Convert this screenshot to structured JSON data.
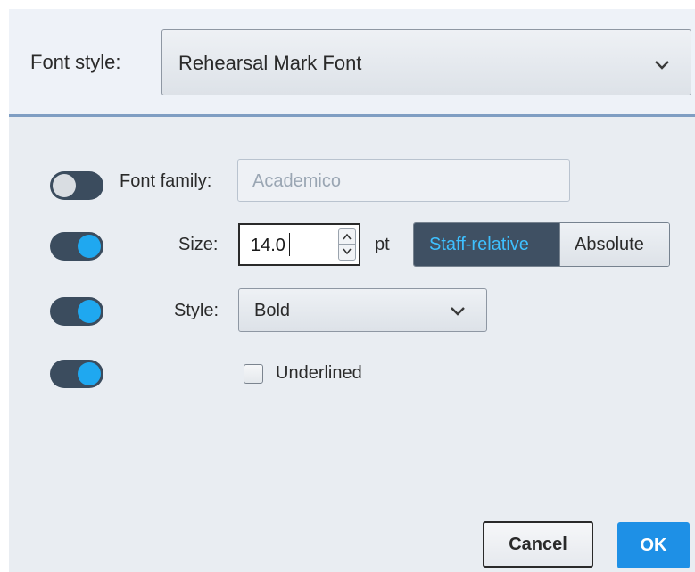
{
  "header": {
    "font_style_label": "Font style:",
    "font_style_value": "Rehearsal Mark Font"
  },
  "font_family": {
    "toggle_on": false,
    "label": "Font family:",
    "placeholder": "Academico"
  },
  "size": {
    "toggle_on": true,
    "label": "Size:",
    "value": "14.0",
    "unit": "pt",
    "mode_options": [
      "Staff-relative",
      "Absolute"
    ],
    "selected_mode": "Staff-relative"
  },
  "style": {
    "toggle_on": true,
    "label": "Style:",
    "value": "Bold"
  },
  "underlined": {
    "toggle_on": true,
    "label": "Underlined",
    "checked": false
  },
  "buttons": {
    "cancel": "Cancel",
    "ok": "OK"
  },
  "colors": {
    "accent": "#1fa8f0",
    "toggle_track": "#3b4c5e",
    "segment_selected_bg": "#3f5063",
    "segment_selected_text": "#3ec0ff",
    "ok_button": "#1e90e6"
  }
}
